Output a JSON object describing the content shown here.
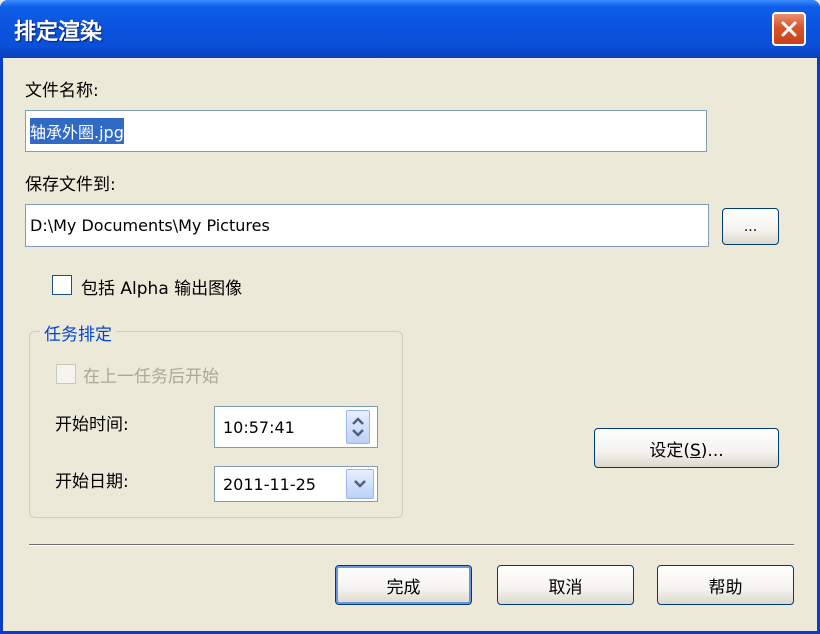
{
  "window": {
    "title": "排定渲染"
  },
  "file_name": {
    "label": "文件名称:",
    "value": "轴承外圈.jpg"
  },
  "save_to": {
    "label": "保存文件到:",
    "value": "D:\\My Documents\\My Pictures",
    "browse_label": "..."
  },
  "include_alpha": {
    "label": "包括 Alpha 输出图像",
    "checked": false
  },
  "schedule": {
    "title": "任务排定",
    "after_prev_label": "在上一任务后开始",
    "start_time_label": "开始时间:",
    "start_time_value": "10:57:41",
    "start_date_label": "开始日期:",
    "start_date_value": "2011-11-25"
  },
  "settings_button": {
    "label": "设定(S)...",
    "base": "设定(",
    "mnemonic": "S",
    "tail": ")..."
  },
  "footer": {
    "finish": "完成",
    "cancel": "取消",
    "help": "帮助"
  },
  "icons": {
    "close": "close-icon",
    "spin": "spin-up-down-icon",
    "dropdown": "chevron-down-icon"
  },
  "colors": {
    "title_bar": "#0a54e0",
    "close": "#d9542a",
    "group_title": "#0046d5",
    "selection": "#316ac5"
  }
}
